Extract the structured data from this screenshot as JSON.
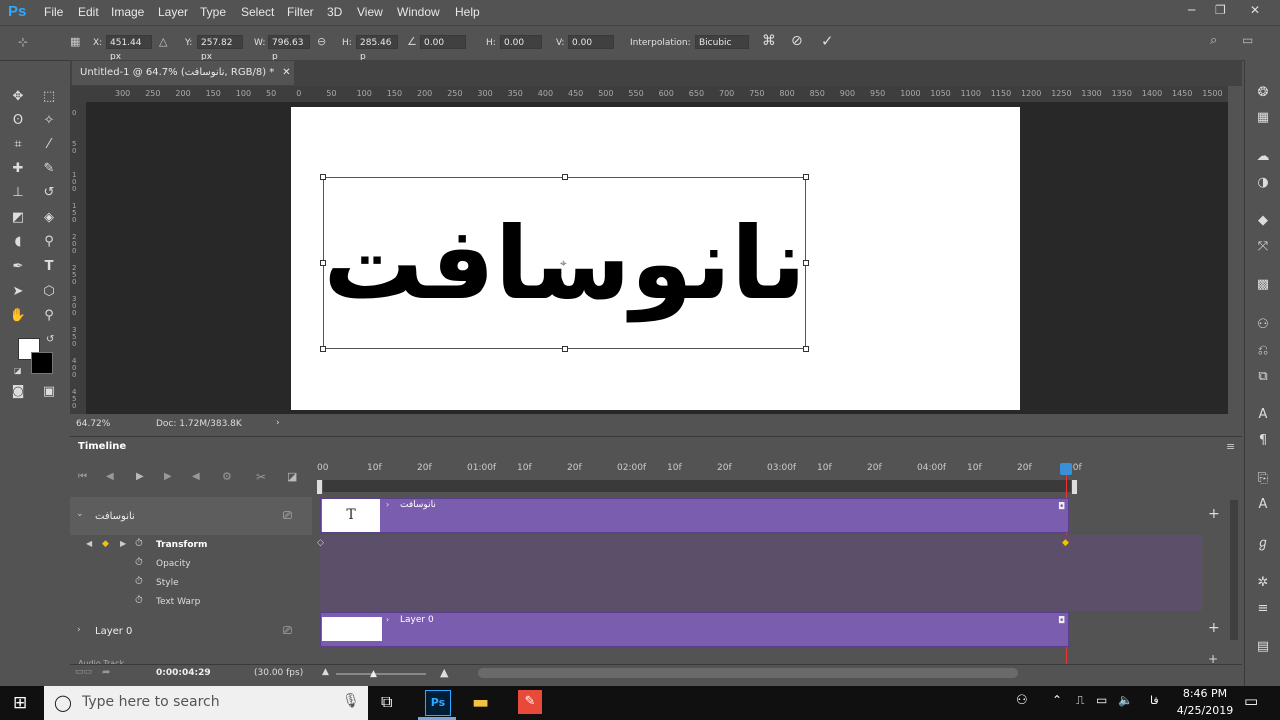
{
  "app": {
    "logo": "Ps"
  },
  "menu": [
    "File",
    "Edit",
    "Image",
    "Layer",
    "Type",
    "Select",
    "Filter",
    "3D",
    "View",
    "Window",
    "Help"
  ],
  "options": {
    "x_label": "X:",
    "x_value": "451.44 px",
    "y_label": "Y:",
    "y_value": "257.82 px",
    "w_label": "W:",
    "w_value": "796.63 p",
    "h_label": "H:",
    "h_value": "285.46 p",
    "angle_value": "0.00",
    "hskew_label": "H:",
    "hskew_value": "0.00",
    "vskew_label": "V:",
    "vskew_value": "0.00",
    "interp_label": "Interpolation:",
    "interp_value": "Bicubic"
  },
  "document": {
    "tab_title": "Untitled-1 @ 64.7% (نانوسافت, RGB/8) *",
    "text_content": "نانوسافت",
    "zoom": "64.72%",
    "doc_size": "Doc: 1.72M/383.8K"
  },
  "ruler": {
    "h_ticks": [
      "300",
      "250",
      "200",
      "150",
      "100",
      "50",
      "0",
      "50",
      "100",
      "150",
      "200",
      "250",
      "300",
      "350",
      "400",
      "450",
      "500",
      "550",
      "600",
      "650",
      "700",
      "750",
      "800",
      "850",
      "900",
      "950",
      "1000",
      "1050",
      "1100",
      "1150",
      "1200",
      "1250",
      "1300",
      "1350",
      "1400",
      "1450",
      "1500"
    ],
    "v_ticks": [
      "0",
      "5 0",
      "1 0 0",
      "1 5 0",
      "2 0 0",
      "2 5 0",
      "3 0 0",
      "3 5 0",
      "4 0 0",
      "4 5 0"
    ]
  },
  "timeline": {
    "title": "Timeline",
    "ticks": [
      "00",
      "10f",
      "20f",
      "01:00f",
      "10f",
      "20f",
      "02:00f",
      "10f",
      "20f",
      "03:00f",
      "10f",
      "20f",
      "04:00f",
      "10f",
      "20f",
      "00f"
    ],
    "layer1_name": "نانوسافت",
    "layer1_clip": "نانوسافت",
    "props": [
      "Transform",
      "Opacity",
      "Style",
      "Text Warp"
    ],
    "layer0_name": "Layer 0",
    "layer0_clip": "Layer 0",
    "audio_label": "Audio Track",
    "timecode": "0:00:04:29",
    "fps": "(30.00 fps)",
    "clip_thumb_text": "T"
  },
  "taskbar": {
    "search_placeholder": "Type here to search",
    "time": "8:46 PM",
    "date": "4/25/2019",
    "lang": "فا"
  },
  "colors": {
    "clip_purple": "#7b5db0",
    "playhead": "#e33",
    "ps_blue": "#31a8ff"
  }
}
